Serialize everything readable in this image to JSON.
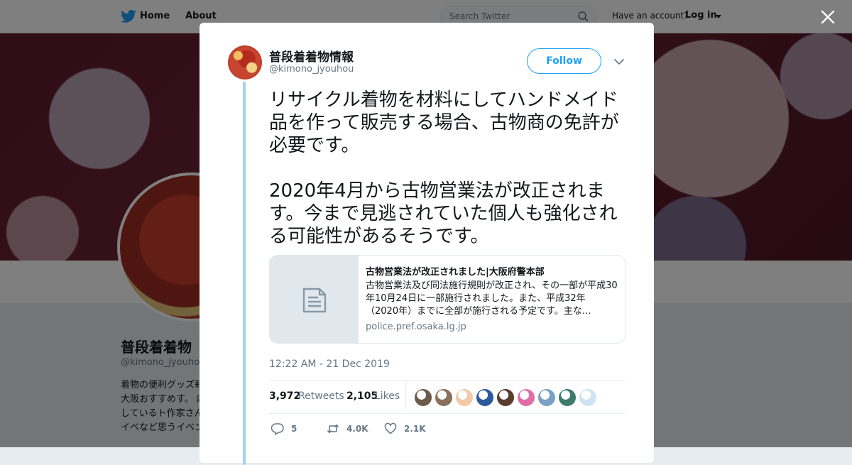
{
  "nav": {
    "home": "Home",
    "about": "About",
    "search_placeholder": "Search Twitter",
    "have_account": "Have an account?",
    "login": "Log in"
  },
  "profile_bg": {
    "name": "普段着着物",
    "handle": "@kimono_jyouho",
    "bio": "着物の便利グッズ報、大阪おすすめす。 応援しているト作家さんのイベなど思うイベント"
  },
  "tweet": {
    "author": {
      "name": "普段着着物情報",
      "handle": "@kimono_jyouhou"
    },
    "follow_label": "Follow",
    "text_paragraphs": [
      "リサイクル着物を材料にしてハンドメイド品を作って販売する場合、古物商の免許が必要です。",
      "2020年4月から古物営業法が改正されます。今まで見逃されていた個人も強化される可能性があるそうです。"
    ],
    "card": {
      "title": "古物営業法が改正されました|大阪府警本部",
      "description": "古物営業法及び同法施行規則が改正され、その一部が平成30年10月24日に一部施行されました。また、平成32年（2020年）までに全部が施行される予定です。主な…",
      "domain": "police.pref.osaka.lg.jp"
    },
    "timestamp": "12:22 AM - 21 Dec 2019",
    "stats": {
      "retweets_count": "3,972",
      "retweets_label": "Retweets",
      "likes_count": "2,105",
      "likes_label": "Likes"
    },
    "liker_colors": [
      "#6b5b4b",
      "#8a6f5a",
      "#f3c9a8",
      "#2c5a9c",
      "#5a3d2b",
      "#e06fa8",
      "#7aa0c4",
      "#3d7a6b",
      "#cfe4f0"
    ],
    "actions": {
      "reply_count": "5",
      "retweet_count": "4.0K",
      "like_count": "2.1K"
    }
  },
  "colors": {
    "accent": "#1da1f2",
    "thread": "#a3d2f4"
  }
}
